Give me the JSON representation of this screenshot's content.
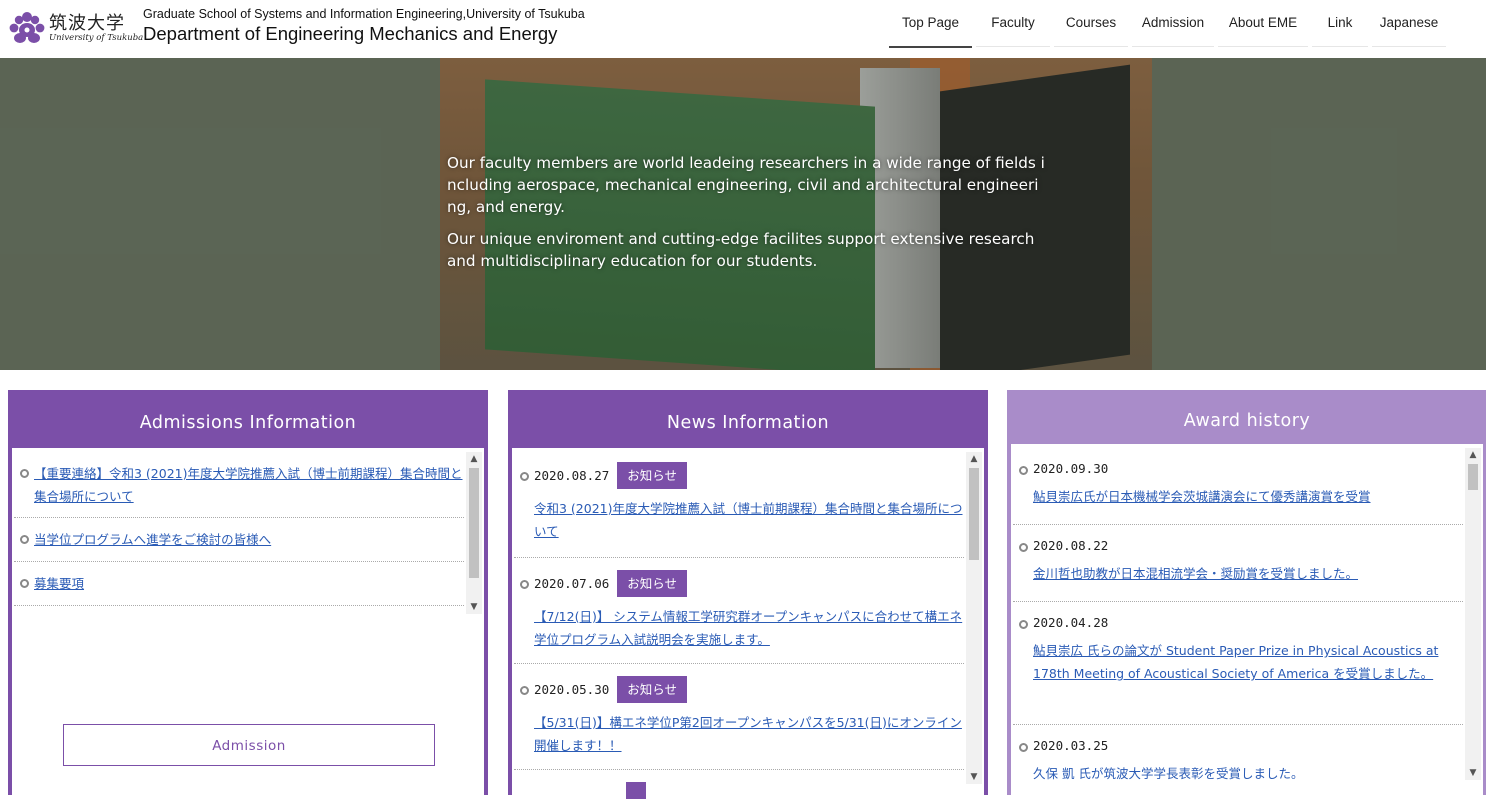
{
  "header": {
    "logo": {
      "jp": "筑波大学",
      "en": "University of Tsukuba"
    },
    "subtitle": "Graduate School of Systems and Information Engineering,University of Tsukuba",
    "title": "Department of Engineering Mechanics and Energy"
  },
  "nav": [
    {
      "label": "Top Page",
      "active": true
    },
    {
      "label": "Faculty"
    },
    {
      "label": "Courses"
    },
    {
      "label": "Admission"
    },
    {
      "label": "About EME"
    },
    {
      "label": "Link"
    },
    {
      "label": "Japanese"
    }
  ],
  "hero": {
    "p1": "Our faculty members are world leadeing researchers in a wide range of fields including aerospace, mechanical engineering, civil and architectural engineering, and energy.",
    "p2": "Our unique enviroment and cutting-edge facilites support extensive research and multidisciplinary education for our students."
  },
  "admissions": {
    "title": "Admissions Information",
    "items": [
      "【重要連絡】令和3 (2021)年度大学院推薦入試（博士前期課程）集合時間と集合場所について",
      "当学位プログラムへ進学をご検討の皆様へ",
      "募集要項"
    ],
    "button": "Admission"
  },
  "news": {
    "title": "News Information",
    "items": [
      {
        "date": "2020.08.27",
        "badge": "お知らせ",
        "text": "令和3 (2021)年度大学院推薦入試（博士前期課程）集合時間と集合場所について"
      },
      {
        "date": "2020.07.06",
        "badge": "お知らせ",
        "text": "【7/12(日)】 システム情報工学研究群オープンキャンパスに合わせて構エネ学位プログラム入試説明会を実施します。"
      },
      {
        "date": "2020.05.30",
        "badge": "お知らせ",
        "text": "【5/31(日)】構エネ学位P第2回オープンキャンパスを5/31(日)にオンライン開催します！！"
      }
    ]
  },
  "awards": {
    "title": "Award history",
    "items": [
      {
        "date": "2020.09.30",
        "text": "鮎貝崇広氏が日本機械学会茨城講演会にて優秀講演賞を受賞"
      },
      {
        "date": "2020.08.22",
        "text": "金川哲也助教が日本混相流学会・奨励賞を受賞しました。"
      },
      {
        "date": "2020.04.28",
        "text": "鮎貝崇広 氏らの論文が Student Paper Prize in Physical Acoustics at 178th Meeting of Acoustical Society of America を受賞しました。"
      },
      {
        "date": "2020.03.25",
        "text": "久保 凱 氏が筑波大学学長表彰を受賞しました。"
      }
    ]
  },
  "colors": {
    "accent": "#7b4fa8",
    "accent_light": "#a98cc9",
    "link": "#2a5bb5"
  },
  "icons": [
    "tsukuba-paulownia-logo-icon",
    "bullet-circle-icon",
    "scroll-up-arrow-icon",
    "scroll-down-arrow-icon"
  ]
}
